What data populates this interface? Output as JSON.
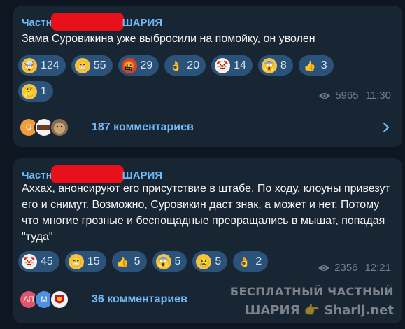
{
  "posts": [
    {
      "channel_prefix": "Частн",
      "channel_suffix": "ШАРИЯ",
      "text": "Зама Суровикина уже выбросили на помойку, он уволен",
      "reactions": [
        {
          "emoji": "exploding-head",
          "count": "124"
        },
        {
          "emoji": "grinning",
          "count": "55"
        },
        {
          "emoji": "cursing",
          "count": "29"
        },
        {
          "emoji": "ok-hand",
          "count": "20"
        },
        {
          "emoji": "clown",
          "count": "14"
        },
        {
          "emoji": "screaming",
          "count": "8"
        },
        {
          "emoji": "thumbs-up",
          "count": "3"
        },
        {
          "emoji": "thinking",
          "count": "1"
        }
      ],
      "views": "5965",
      "time": "11:30",
      "comments": "187 комментариев",
      "avatars": [
        "О",
        "",
        ""
      ]
    },
    {
      "channel_prefix": "Частн",
      "channel_suffix": "ШАРИЯ",
      "text": "Аххах, анонсируют его присутствие в штабе. По ходу, клоуны привезут его и снимут. Возможно, Суровикин даст знак, а может и нет. Потому что многие грозные и беспощадные превращались в мышат, попадая \"туда\"",
      "reactions": [
        {
          "emoji": "clown",
          "count": "45"
        },
        {
          "emoji": "grinning",
          "count": "15"
        },
        {
          "emoji": "thumbs-up",
          "count": "5"
        },
        {
          "emoji": "screaming",
          "count": "5"
        },
        {
          "emoji": "crying",
          "count": "5"
        },
        {
          "emoji": "ok-hand",
          "count": "2"
        }
      ],
      "views": "2356",
      "time": "12:21",
      "comments": "36 комментариев",
      "avatars": [
        "АП",
        "М",
        ""
      ]
    }
  ],
  "watermark": {
    "line1": "БЕСПЛАТНЫЙ ЧАСТНЫЙ",
    "line2": "ШАРИЯ 👉 Sharij.net"
  },
  "colors": {
    "background": "#0e1621",
    "bubble": "#182533",
    "accent": "#71baf7",
    "reaction_bg": "#2b5278",
    "redaction": "#e8101a"
  }
}
